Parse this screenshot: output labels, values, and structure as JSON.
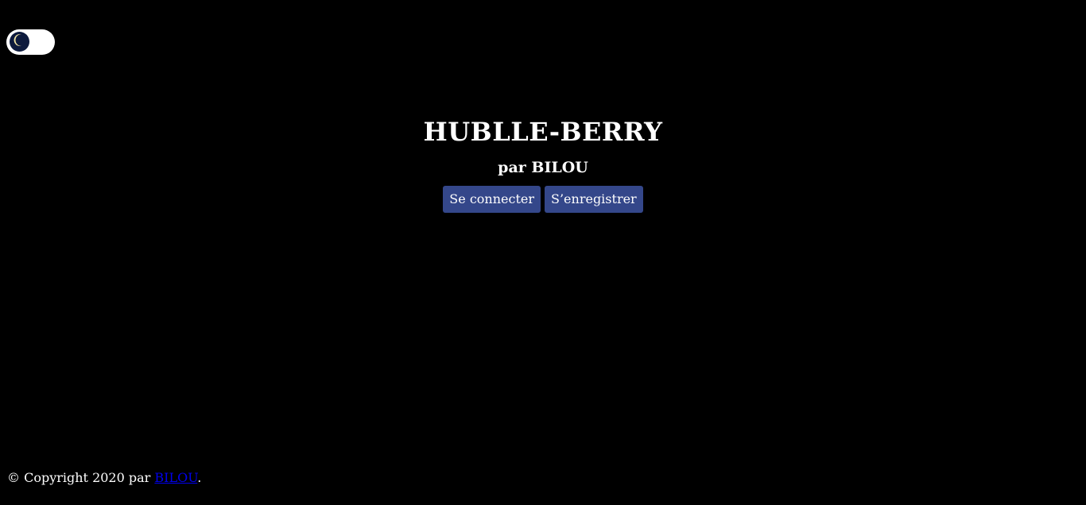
{
  "theme_toggle": {
    "icon": "moon-icon",
    "mode": "dark"
  },
  "header": {
    "title": "HUBLLE-BERRY",
    "subtitle": "par BILOU"
  },
  "auth": {
    "login_label": "Se connecter",
    "register_label": "S’enregistrer"
  },
  "footer": {
    "prefix": "© Copyright 2020 par ",
    "author_link": "BILOU",
    "suffix": "."
  },
  "colors": {
    "background": "#000000",
    "button": "#34478a",
    "link": "#0000ee",
    "toggle_knob": "#0d1a3d",
    "moon": "#f3e7a5"
  }
}
